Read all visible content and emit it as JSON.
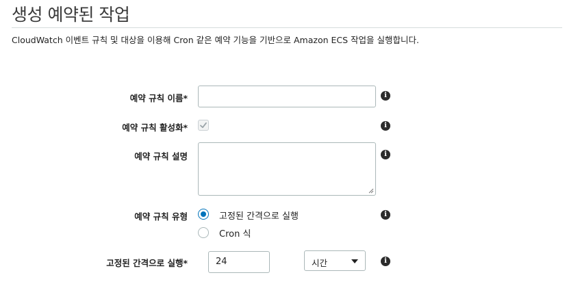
{
  "page": {
    "title": "생성 예약된 작업",
    "description": "CloudWatch 이벤트 규칙 및 대상을 이용해 Cron 같은 예약 기능을 기반으로 Amazon ECS 작업을 실행합니다."
  },
  "form": {
    "rule_name": {
      "label": "예약 규칙 이름*",
      "value": "",
      "placeholder": ""
    },
    "rule_enabled": {
      "label": "예약 규칙 활성화*",
      "checked": true
    },
    "rule_description": {
      "label": "예약 규칙 설명",
      "value": ""
    },
    "rule_type": {
      "label": "예약 규칙 유형",
      "options": [
        {
          "label": "고정된 간격으로 실행",
          "selected": true
        },
        {
          "label": "Cron 식",
          "selected": false
        }
      ]
    },
    "fixed_interval": {
      "label": "고정된 간격으로 실행*",
      "value": "24",
      "unit": "시간"
    }
  },
  "icons": {
    "info": "info-icon",
    "info_glyph": "i"
  },
  "colors": {
    "accent": "#0073bb",
    "border": "#aab7b8"
  }
}
